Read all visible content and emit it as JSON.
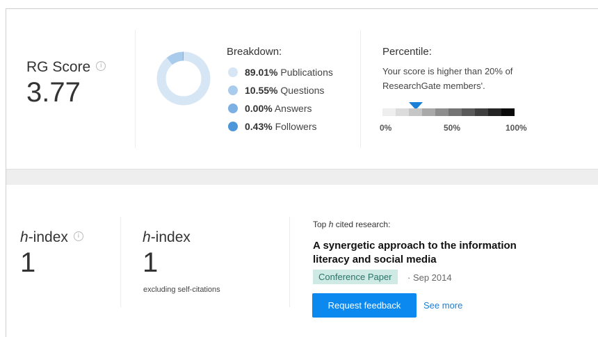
{
  "rg_score": {
    "label": "RG Score",
    "info_icon": "info-icon",
    "value": "3.77"
  },
  "breakdown": {
    "title": "Breakdown:",
    "chart_data": {
      "type": "pie",
      "labels": [
        "Publications",
        "Questions",
        "Answers",
        "Followers"
      ],
      "values": [
        89.01,
        10.55,
        0.0,
        0.43
      ],
      "colors": [
        "#d6e6f4",
        "#a9cbec",
        "#7cb0e3",
        "#4c97da"
      ]
    },
    "items": [
      {
        "pct": "89.01%",
        "label": " Publications",
        "color": "#d6e6f4"
      },
      {
        "pct": "10.55%",
        "label": " Questions",
        "color": "#a9cbec"
      },
      {
        "pct": "0.00%",
        "label": " Answers",
        "color": "#7cb0e3"
      },
      {
        "pct": "0.43%",
        "label": " Followers",
        "color": "#4c97da"
      }
    ]
  },
  "percentile": {
    "title": "Percentile:",
    "text": "Your score is higher than 20% of ResearchGate members'.",
    "value": 20,
    "marker_color": "#1a7fd6",
    "scale_labels": [
      "0%",
      "50%",
      "100%"
    ]
  },
  "h_index": {
    "label_italic": "h",
    "label_rest": "-index",
    "info_icon": "info-icon",
    "value": "1"
  },
  "h_index_excl": {
    "label_italic": "h",
    "label_rest": "-index",
    "value": "1",
    "sublabel": "excluding self-citations"
  },
  "top_cited": {
    "heading_pre": "Top ",
    "heading_italic": "h",
    "heading_post": " cited research:",
    "title": "A synergetic approach to the information literacy and social media",
    "badge": "Conference Paper",
    "date": "· Sep 2014",
    "button": "Request feedback",
    "link": "See more"
  }
}
